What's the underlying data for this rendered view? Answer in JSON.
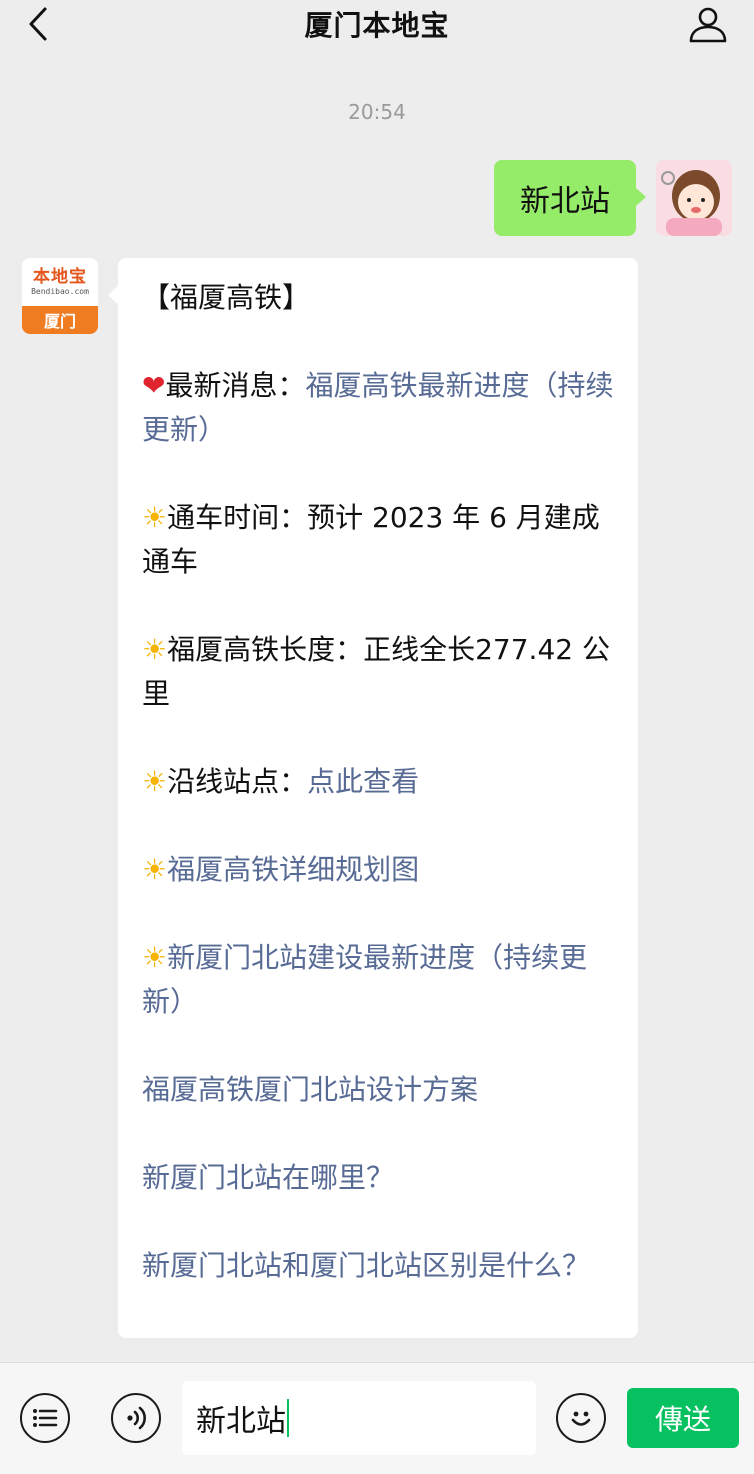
{
  "header": {
    "title": "厦门本地宝",
    "back_icon": "chevron-left-icon",
    "profile_icon": "person-icon"
  },
  "chat": {
    "time": "20:54",
    "user_message": "新北站",
    "bot_avatar": {
      "brand": "本地宝",
      "domain": "Bendibao.com",
      "city": "厦门"
    },
    "bot_message": {
      "title": "【福厦高铁】",
      "latest_label": "最新消息：",
      "latest_link": "福厦高铁最新进度（持续更新）",
      "open_time": "通车时间：预计 2023 年 6 月建成通车",
      "length": "福厦高铁长度：正线全长277.42 公里",
      "stations_label": "沿线站点：",
      "stations_link": "点此查看",
      "plan_link": "福厦高铁详细规划图",
      "north_progress_link": "新厦门北站建设最新进度（持续更新）",
      "design_link": "福厦高铁厦门北站设计方案",
      "where_link": "新厦门北站在哪里？",
      "difference_link": "新厦门北站和厦门北站区别是什么？"
    }
  },
  "inputbar": {
    "input_value": "新北站",
    "send_label": "傳送",
    "menu_icon": "list-icon",
    "voice_icon": "voice-icon",
    "emoji_icon": "smiley-icon"
  },
  "colors": {
    "accent": "#07c160",
    "user_bubble": "#95ec69",
    "link": "#576b95",
    "background": "#ededed"
  }
}
